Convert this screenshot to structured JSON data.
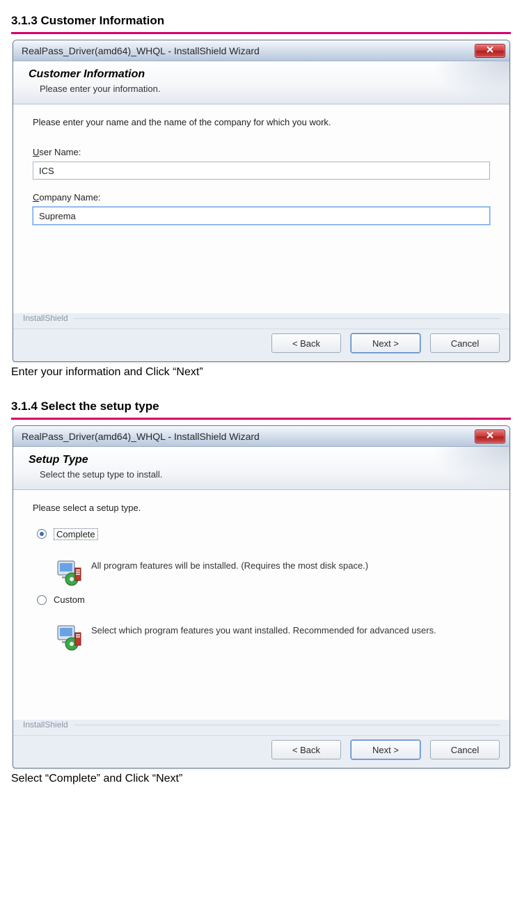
{
  "section1": {
    "heading": "3.1.3 Customer Information",
    "caption": "Enter your information and Click “Next”",
    "dialog": {
      "window_title": "RealPass_Driver(amd64)_WHQL - InstallShield Wizard",
      "header_title": "Customer Information",
      "header_sub": "Please enter your information.",
      "instruction": "Please enter your name and the name of the company for which you work.",
      "user_label": "User Name:",
      "user_value": "ICS",
      "company_label": "Company Name:",
      "company_value": "Suprema",
      "installshield_label": "InstallShield",
      "back_label": "< Back",
      "next_label": "Next >",
      "cancel_label": "Cancel"
    }
  },
  "section2": {
    "heading": "3.1.4 Select the setup type",
    "caption": "Select “Complete” and Click “Next”",
    "dialog": {
      "window_title": "RealPass_Driver(amd64)_WHQL - InstallShield Wizard",
      "header_title": "Setup Type",
      "header_sub": "Select the setup type to install.",
      "instruction": "Please select a setup type.",
      "options": [
        {
          "label": "Complete",
          "checked": true,
          "description": "All program features will be installed. (Requires the most disk space.)"
        },
        {
          "label": "Custom",
          "checked": false,
          "description": "Select which program features you want installed. Recommended for advanced users."
        }
      ],
      "installshield_label": "InstallShield",
      "back_label": "< Back",
      "next_label": "Next >",
      "cancel_label": "Cancel"
    }
  }
}
